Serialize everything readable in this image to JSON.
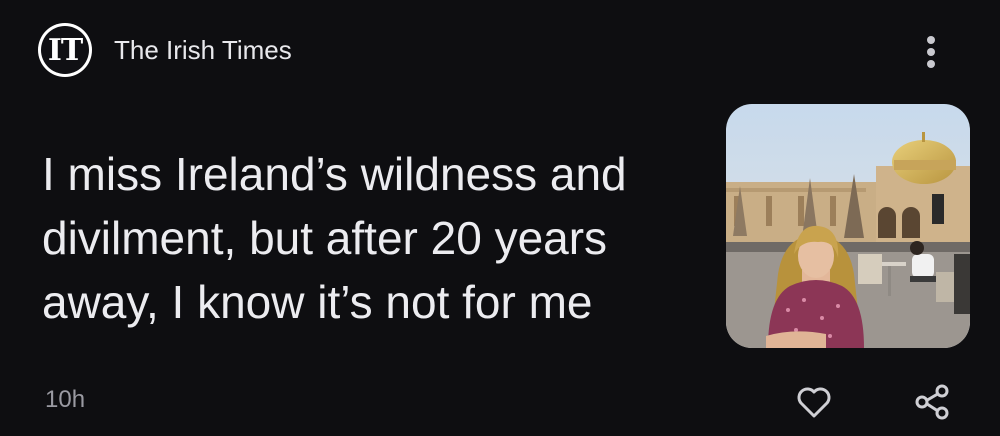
{
  "publisher": {
    "logo_text": "IT",
    "name": "The Irish Times"
  },
  "article": {
    "headline": "I miss Ireland’s wildness and divilment, but after 20 years away, I know it’s not for me",
    "timestamp": "10h",
    "thumbnail_description": "woman seated at outdoor cafe in front of domed building"
  },
  "icons": {
    "menu": "more-vert-icon",
    "like": "heart-outline-icon",
    "share": "share-icon"
  },
  "colors": {
    "background": "#0e0e11",
    "text": "#ececf0",
    "muted": "#9a9aa2"
  }
}
